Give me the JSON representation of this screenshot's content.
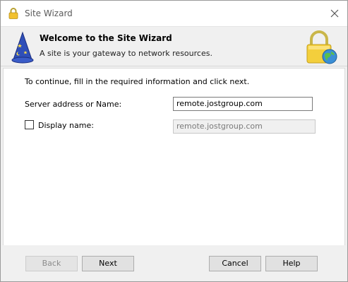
{
  "window": {
    "title": "Site Wizard",
    "title_icon": "lock-icon",
    "close_icon": "close-icon"
  },
  "header": {
    "title": "Welcome to the Site Wizard",
    "subtitle": "A site is your gateway to network resources.",
    "left_icon": "wizard-hat-icon",
    "right_icon": "lock-globe-icon"
  },
  "content": {
    "instruction": "To continue, fill in the required information and click next.",
    "server": {
      "label": "Server address or Name:",
      "value": "remote.jostgroup.com"
    },
    "display_name": {
      "label": "Display name:",
      "checked": false,
      "value": "remote.jostgroup.com"
    }
  },
  "footer": {
    "back_label": "Back",
    "next_label": "Next",
    "cancel_label": "Cancel",
    "help_label": "Help"
  },
  "colors": {
    "window_bg": "#f0f0f0",
    "content_bg": "#ffffff",
    "button_bg": "#e1e1e1",
    "disabled_text": "#8c8c8c"
  }
}
